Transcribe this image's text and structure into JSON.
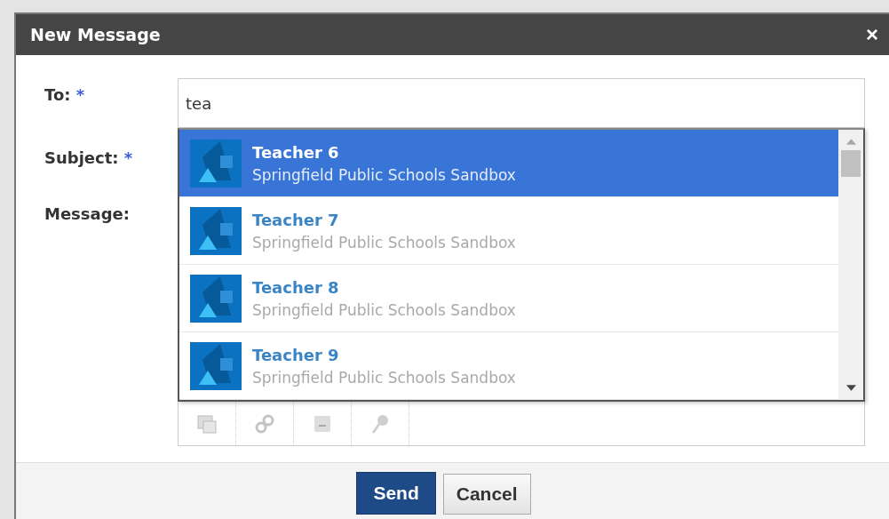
{
  "window": {
    "title": "New Message",
    "close": "×"
  },
  "form": {
    "to": {
      "label": "To:",
      "required": "*",
      "value": "tea"
    },
    "subject": {
      "label": "Subject:",
      "required": "*"
    },
    "message": {
      "label": "Message:"
    }
  },
  "suggestions": [
    {
      "name": "Teacher 6",
      "org": "Springfield Public Schools Sandbox",
      "selected": true
    },
    {
      "name": "Teacher 7",
      "org": "Springfield Public Schools Sandbox",
      "selected": false
    },
    {
      "name": "Teacher 8",
      "org": "Springfield Public Schools Sandbox",
      "selected": false
    },
    {
      "name": "Teacher 9",
      "org": "Springfield Public Schools Sandbox",
      "selected": false
    }
  ],
  "buttons": {
    "send": "Send",
    "cancel": "Cancel"
  }
}
